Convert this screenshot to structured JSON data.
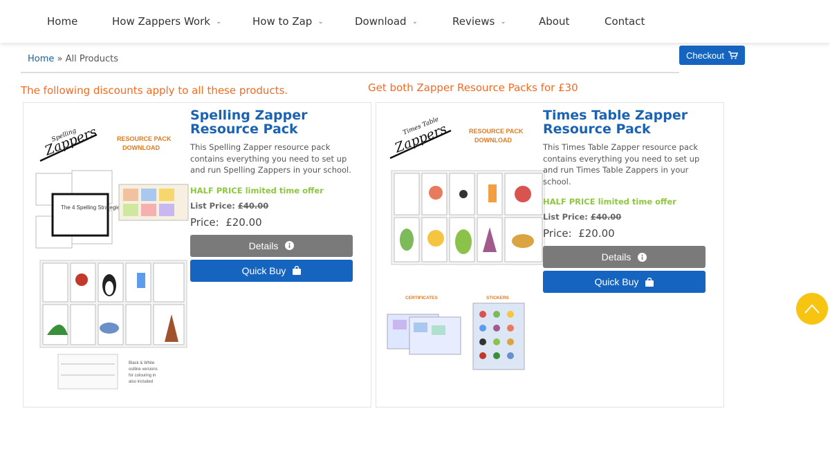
{
  "nav": {
    "items": [
      {
        "label": "Home",
        "has_dropdown": false
      },
      {
        "label": "How Zappers Work",
        "has_dropdown": true
      },
      {
        "label": "How to Zap",
        "has_dropdown": true
      },
      {
        "label": "Download",
        "has_dropdown": true
      },
      {
        "label": "Reviews",
        "has_dropdown": true
      },
      {
        "label": "About",
        "has_dropdown": false
      },
      {
        "label": "Contact",
        "has_dropdown": false
      }
    ],
    "dropdown_icon": "chevron-down-icon"
  },
  "breadcrumb": {
    "home": "Home",
    "separator": "»",
    "current": "All Products"
  },
  "checkout": {
    "label": "Checkout",
    "icon": "cart-icon"
  },
  "notes": {
    "discounts": "The following discounts apply to all these products.",
    "bundle": "Get both Zapper Resource Packs for £30"
  },
  "products": [
    {
      "title": "Spelling Zapper Resource Pack",
      "description": "This Spelling Zapper resource pack contains everything you need to set up and run Spelling Zappers in your school.",
      "offer": "HALF PRICE limited time offer",
      "list_price_label": "List Price:",
      "list_price": "£40.00",
      "price_label": "Price:",
      "price": "£20.00",
      "details_label": "Details",
      "quick_buy_label": "Quick Buy",
      "image_text": {
        "logo_top": "Spelling",
        "logo_main": "Zappers",
        "pack_line1": "RESOURCE PACK",
        "pack_line2": "DOWNLOAD",
        "sheet_title": "The 4 Spelling Strategies",
        "bw_note": [
          "Black & White",
          "outline versions",
          "for colouring in",
          "also included"
        ]
      }
    },
    {
      "title": "Times Table Zapper Resource Pack",
      "description": "This Times Table Zapper resource pack contains everything you need to set up and run Times Table Zappers in your school.",
      "offer": "HALF PRICE limited time offer",
      "list_price_label": "List Price:",
      "list_price": "£40.00",
      "price_label": "Price:",
      "price": "£20.00",
      "details_label": "Details",
      "quick_buy_label": "Quick Buy",
      "image_text": {
        "logo_top": "Times Table",
        "logo_main": "Zappers",
        "pack_line1": "RESOURCE PACK",
        "pack_line2": "DOWNLOAD",
        "certificates": "CERTIFICATES",
        "stickers": "STICKERS"
      }
    }
  ],
  "colors": {
    "accent_blue": "#1565c0",
    "title_blue": "#1b63b0",
    "orange": "#f26b21",
    "offer_green": "#8dc63f",
    "scroll_top_yellow": "#f7c412"
  },
  "scroll_top": {
    "icon": "chevron-up-icon"
  }
}
